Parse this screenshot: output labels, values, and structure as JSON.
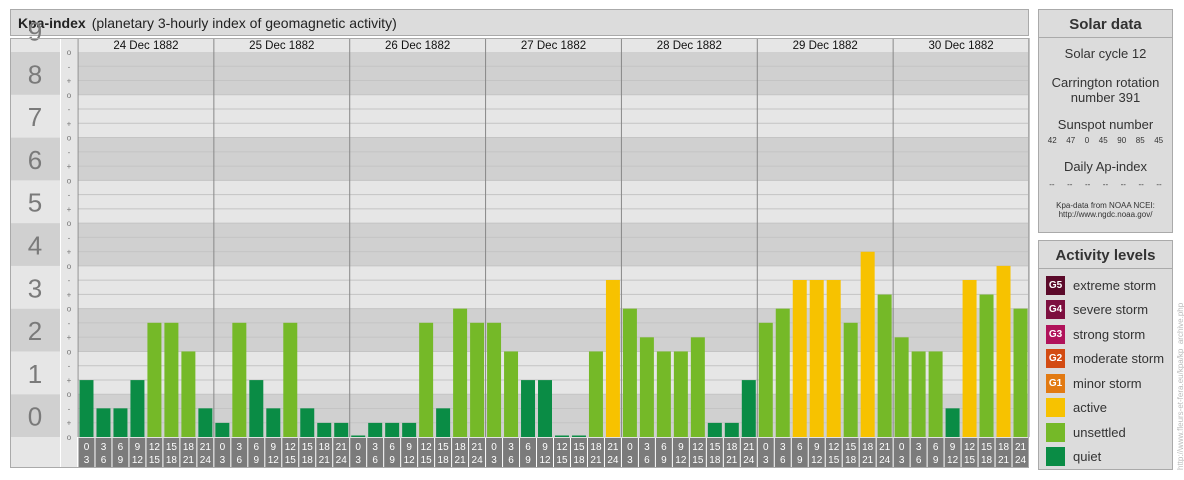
{
  "title": "Kpa-index",
  "subtitle": "(planetary 3-hourly index of geomagnetic activity)",
  "chart_data": {
    "type": "bar",
    "ylim": [
      0,
      9
    ],
    "y_ticks": [
      "0",
      "1",
      "2",
      "3",
      "4",
      "5",
      "6",
      "7",
      "8",
      "9"
    ],
    "sub_ticks": [
      "+",
      "o",
      "-"
    ],
    "days": [
      "24 Dec 1882",
      "25 Dec 1882",
      "26 Dec 1882",
      "27 Dec 1882",
      "28 Dec 1882",
      "29 Dec 1882",
      "30 Dec 1882"
    ],
    "interval_starts": [
      "0",
      "3",
      "6",
      "9",
      "12",
      "15",
      "18",
      "21"
    ],
    "interval_ends": [
      "3",
      "6",
      "9",
      "12",
      "15",
      "18",
      "21",
      "24"
    ],
    "values": [
      [
        1.33,
        0.67,
        0.67,
        1.33,
        2.67,
        2.67,
        2.0,
        0.67
      ],
      [
        0.33,
        2.67,
        1.33,
        0.67,
        2.67,
        0.67,
        0.33,
        0.33
      ],
      [
        0.0,
        0.33,
        0.33,
        0.33,
        2.67,
        0.67,
        3.0,
        2.67
      ],
      [
        2.67,
        2.0,
        1.33,
        1.33,
        0.0,
        0.0,
        2.0,
        3.67
      ],
      [
        3.0,
        2.33,
        2.0,
        2.0,
        2.33,
        0.33,
        0.33,
        1.33
      ],
      [
        2.67,
        3.0,
        3.67,
        3.67,
        3.67,
        2.67,
        4.33,
        3.33
      ],
      [
        2.33,
        2.0,
        2.0,
        0.67,
        3.67,
        3.33,
        4.0,
        3.0
      ]
    ],
    "colors": {
      "quiet": "#0a8c45",
      "unsettled": "#75b928",
      "active": "#f7c200"
    }
  },
  "solar": {
    "title": "Solar data",
    "cycle": "Solar cycle 12",
    "carrington_1": "Carrington rotation",
    "carrington_2": "number 391",
    "sunspot_label": "Sunspot number",
    "sunspot_values": [
      "42",
      "47",
      "0",
      "45",
      "90",
      "85",
      "45"
    ],
    "ap_label": "Daily Ap-index",
    "ap_values": [
      "--",
      "--",
      "--",
      "--",
      "--",
      "--",
      "--"
    ],
    "source_1": "Kpa-data from NOAA NCEI:",
    "source_2": "http://www.ngdc.noaa.gov/"
  },
  "activity": {
    "title": "Activity levels",
    "levels": [
      {
        "code": "G5",
        "label": "extreme storm",
        "color": "#5b0a2a"
      },
      {
        "code": "G4",
        "label": "severe storm",
        "color": "#7d0f3f"
      },
      {
        "code": "G3",
        "label": "strong storm",
        "color": "#b0125a"
      },
      {
        "code": "G2",
        "label": "moderate storm",
        "color": "#d34b12"
      },
      {
        "code": "G1",
        "label": "minor storm",
        "color": "#e27a12"
      },
      {
        "code": "",
        "label": "active",
        "color": "#f7c200"
      },
      {
        "code": "",
        "label": "unsettled",
        "color": "#75b928"
      },
      {
        "code": "",
        "label": "quiet",
        "color": "#0a8c45"
      }
    ]
  },
  "credit": "http://www.fleurs-et-fera.eu/kpa/kp_archive.php"
}
